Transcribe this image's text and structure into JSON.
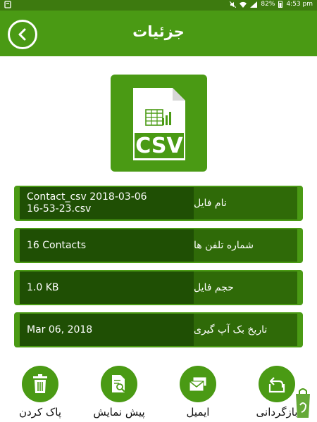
{
  "status_bar": {
    "battery": "82%",
    "time": "4:53 pm"
  },
  "header": {
    "title": "جزئیات"
  },
  "file": {
    "type_label": "CSV"
  },
  "details": [
    {
      "label": "نام فایل",
      "value_line1": "Contact_csv 2018-03-06",
      "value_line2": "16-53-23.csv"
    },
    {
      "label": "شماره تلفن ها",
      "value_line1": "16 Contacts",
      "value_line2": ""
    },
    {
      "label": "حجم فایل",
      "value_line1": "1.0 KB",
      "value_line2": ""
    },
    {
      "label": "تاریخ بک آپ گیری",
      "value_line1": "Mar 06, 2018",
      "value_line2": ""
    }
  ],
  "actions": {
    "delete": "پاک کردن",
    "preview": "پیش نمایش",
    "email": "ایمیل",
    "restore": "بازگردانی"
  },
  "colors": {
    "primary": "#4a9a14",
    "status_bar": "#3d7a0f",
    "row_label_bg": "#2f6a08",
    "row_value_bg": "#1f4f04"
  }
}
